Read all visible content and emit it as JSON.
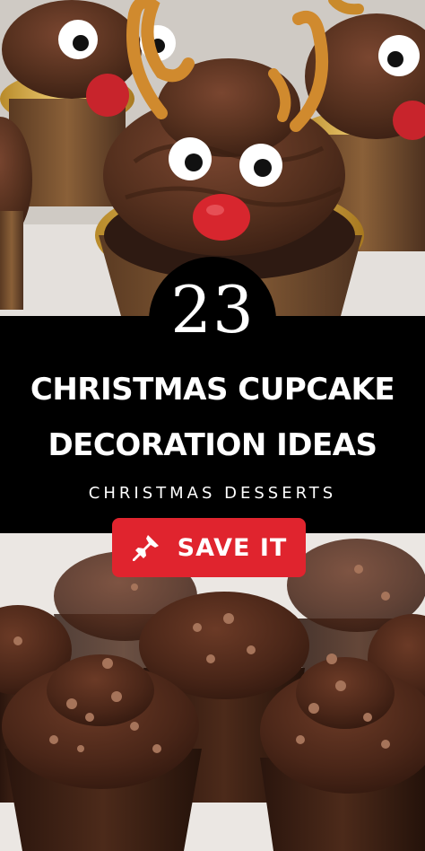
{
  "pin": {
    "number": "23",
    "title_line1": "CHRISTMAS CUPCAKE",
    "title_line2": "DECORATION IDEAS",
    "category": "CHRISTMAS DESSERTS",
    "save_button": {
      "label": "SAVE IT",
      "icon": "pushpin-icon"
    }
  },
  "colors": {
    "band": "#000000",
    "button": "#e0242e",
    "text": "#ffffff"
  }
}
